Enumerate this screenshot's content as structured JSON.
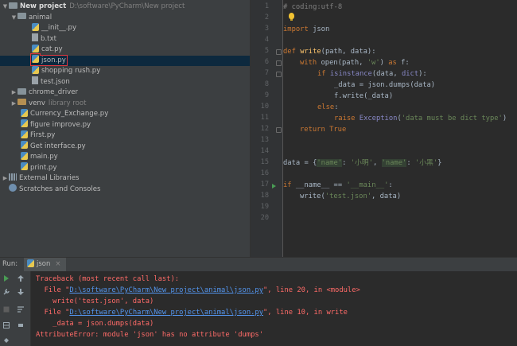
{
  "project_tree": {
    "root": {
      "label": "New project",
      "path": "D:\\software\\PyCharm\\New project"
    },
    "items": [
      {
        "label": "animal"
      },
      {
        "label": "__init__.py"
      },
      {
        "label": "b.txt"
      },
      {
        "label": "cat.py"
      },
      {
        "label": "json.py"
      },
      {
        "label": "shopping rush.py"
      },
      {
        "label": "test.json"
      },
      {
        "label": "chrome_driver"
      },
      {
        "label": "venv",
        "suffix": "library root"
      },
      {
        "label": "Currency_Exchange.py"
      },
      {
        "label": "figure improve.py"
      },
      {
        "label": "First.py"
      },
      {
        "label": "Get interface.py"
      },
      {
        "label": "main.py"
      },
      {
        "label": "print.py"
      },
      {
        "label": "External Libraries"
      },
      {
        "label": "Scratches and Consoles"
      }
    ]
  },
  "editor": {
    "line_numbers": [
      "1",
      "2",
      "3",
      "4",
      "5",
      "6",
      "7",
      "8",
      "9",
      "10",
      "11",
      "12",
      "13",
      "14",
      "15",
      "16",
      "17",
      "18",
      "19",
      "20"
    ],
    "code": {
      "l1_comment": "# coding:utf-8",
      "l3_kw": "import",
      "l3_rest": " json",
      "l5_kw": "def",
      "l5_fn": "write",
      "l5_rest": "(path, data):",
      "l6_kw": "with",
      "l6_a": " open(path, ",
      "l6_str": "'w'",
      "l6_b": ") ",
      "l6_as": "as",
      "l6_c": " f:",
      "l7_kw": "if",
      "l7_bi": "isinstance",
      "l7_a": "(data, ",
      "l7_dict": "dict",
      "l7_b": "):",
      "l8": "_data = json.dumps(data)",
      "l9": "f.write(_data)",
      "l10_kw": "else",
      "l10_rest": ":",
      "l11_kw": "raise",
      "l11_bi": "Exception",
      "l11_a": "(",
      "l11_str": "'data must be dict type'",
      "l11_b": ")",
      "l12_kw": "return",
      "l12_true": "True",
      "l15_a": "data = {",
      "l15_k1": "'name'",
      "l15_b": ": ",
      "l15_v1": "'小明'",
      "l15_c": ", ",
      "l15_k2": "'name'",
      "l15_d": ": ",
      "l15_v2": "'小黑'",
      "l15_e": "}",
      "l17_kw": "if",
      "l17_a": " __name__ == ",
      "l17_str": "'__main__'",
      "l17_b": ":",
      "l18_a": "write(",
      "l18_str": "'test.json'",
      "l18_b": ", data)"
    }
  },
  "run_panel": {
    "label": "Run:",
    "tab": "json",
    "close": "×",
    "output": {
      "l1": "Traceback (most recent call last):",
      "l2_a": "  File \"",
      "l2_link": "D:\\software\\PyCharm\\New project\\animal\\json.py",
      "l2_b": "\", line 20, in <module>",
      "l3": "    write('test.json', data)",
      "l4_a": "  File \"",
      "l4_link": "D:\\software\\PyCharm\\New project\\animal\\json.py",
      "l4_b": "\", line 10, in write",
      "l5": "    _data = json.dumps(data)",
      "l6": "AttributeError: module 'json' has no attribute 'dumps'"
    }
  },
  "colors": {
    "error": "#ff6b68",
    "link": "#5394ec",
    "selection": "#0d293e",
    "highlight_box": "#e0383e"
  }
}
